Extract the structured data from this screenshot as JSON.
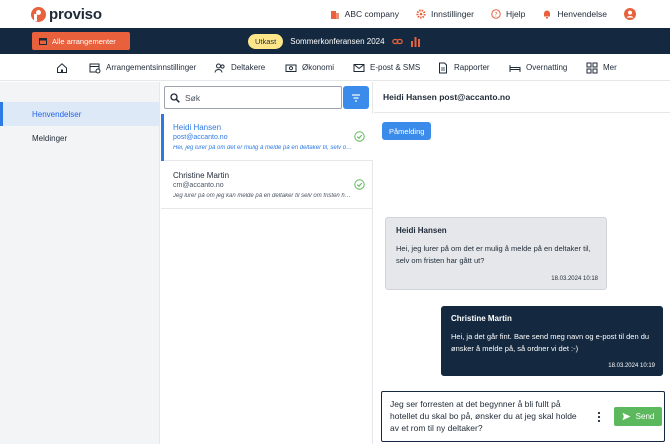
{
  "brand": {
    "logo_text": "proviso",
    "accent": "#e8603c",
    "dark": "#14293f",
    "blue": "#2c7be5"
  },
  "topbar": {
    "company": "ABC company",
    "settings": "Innstillinger",
    "help": "Hjelp",
    "inquiries": "Henvendelse"
  },
  "eventbar": {
    "all_events": "Alle arrangementer",
    "status": "Utkast",
    "event_name": "Sommerkonferansen 2024"
  },
  "nav": {
    "settings": "Arrangementsinnstillinger",
    "participants": "Deltakere",
    "economy": "Økonomi",
    "email_sms": "E-post & SMS",
    "reports": "Rapporter",
    "accommodation": "Overnatting",
    "more": "Mer"
  },
  "sidebar": {
    "items": [
      {
        "label": "Henvendelser"
      },
      {
        "label": "Meldinger"
      }
    ]
  },
  "list": {
    "search_placeholder": "Søk",
    "conversations": [
      {
        "name": "Heidi Hansen",
        "email": "post@accanto.no",
        "snippet": "Hei, jeg lurer på om det er mulig å melde på en deltaker til, selv om fristen har gått ut?"
      },
      {
        "name": "Christine Martin",
        "email": "cm@accanto.no",
        "snippet": "Jeg lurer på om jeg kan melde på en deltaker til selv om fristen har gått ut?"
      }
    ]
  },
  "chat": {
    "header": "Heidi Hansen post@accanto.no",
    "tag": "Påmelding",
    "messages": [
      {
        "name": "Heidi Hansen",
        "text": "Hei, jeg lurer på om det er mulig å melde på en deltaker til, selv om fristen har gått ut?",
        "time": "18.03.2024 10:18"
      },
      {
        "name": "Christine Martin",
        "text": "Hei, ja det går fint. Bare send meg navn og e-post til den du ønsker å melde på, så ordner vi det :-)",
        "time": "18.03.2024 10:19"
      }
    ],
    "draft": "Jeg ser forresten at det begynner å bli fullt på hotellet du skal bo på, ønsker du at jeg skal holde av et rom til ny deltaker?",
    "send_label": "Send"
  }
}
